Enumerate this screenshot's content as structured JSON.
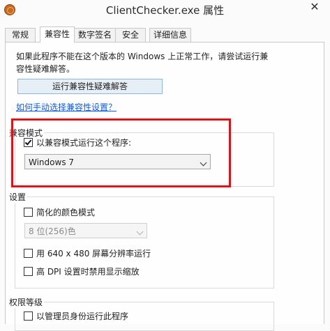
{
  "window": {
    "title": "ClientChecker.exe 属性",
    "close_glyph": "✕"
  },
  "tabs": [
    {
      "label": "常规",
      "active": false
    },
    {
      "label": "兼容性",
      "active": true
    },
    {
      "label": "数字签名",
      "active": false
    },
    {
      "label": "安全",
      "active": false
    },
    {
      "label": "详细信息",
      "active": false
    }
  ],
  "intro": {
    "line1": "如果此程序不能在这个版本的 Windows 上正常工作，请尝试运行兼",
    "line2": "容性疑难解答。"
  },
  "troubleshoot_button": "运行兼容性疑难解答",
  "manual_link": "如何手动选择兼容性设置？",
  "compat_mode": {
    "legend": "兼容模式",
    "checkbox_label": "以兼容模式运行这个程序:",
    "checked": true,
    "selected_os": "Windows 7"
  },
  "settings": {
    "legend": "设置",
    "reduced_color_label": "简化的颜色模式",
    "reduced_color_checked": false,
    "color_depth_value": "8 位(256)色",
    "resolution_label": "用 640 x 480 屏幕分辨率运行",
    "resolution_checked": false,
    "dpi_label": "高 DPI 设置时禁用显示缩放",
    "dpi_checked": false
  },
  "privilege": {
    "legend": "权限等级",
    "admin_label": "以管理员身份运行此程序",
    "admin_checked": false
  },
  "colors": {
    "highlight_frame": "#d4151b",
    "link": "#0a5bd8"
  }
}
